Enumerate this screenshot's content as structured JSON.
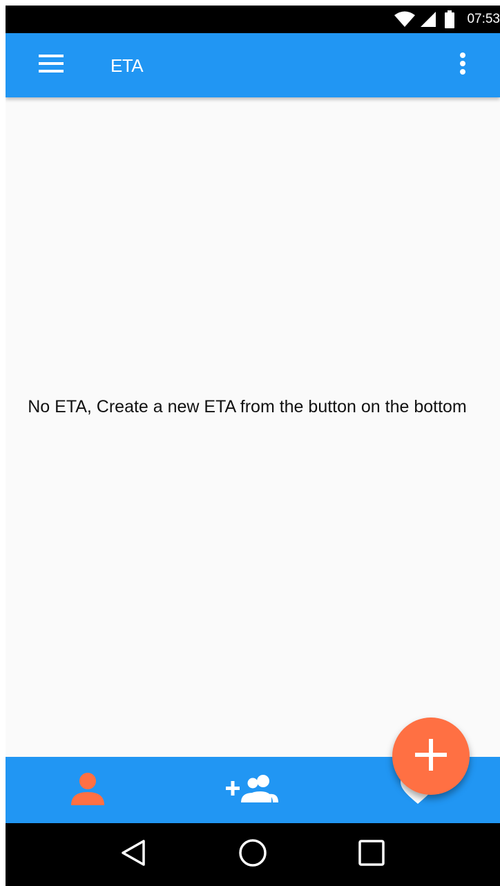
{
  "status_bar": {
    "time": "07:53",
    "icons": [
      "wifi-icon",
      "signal-icon",
      "battery-icon"
    ]
  },
  "app_bar": {
    "title": "ETA",
    "menu_icon": "menu-icon",
    "overflow_icon": "more-vert-icon"
  },
  "content": {
    "empty_message": "No ETA, Create a new ETA from the button on the bottom"
  },
  "fab": {
    "icon": "add-icon"
  },
  "bottom_nav": {
    "items": [
      {
        "icon": "person-icon",
        "active": true
      },
      {
        "icon": "group-add-icon",
        "active": false
      },
      {
        "icon": "heart-icon",
        "active": false
      }
    ]
  },
  "system_nav": {
    "buttons": [
      "back-icon",
      "home-icon",
      "recents-icon"
    ]
  },
  "colors": {
    "primary": "#2196f3",
    "accent": "#ff7043",
    "background": "#fafafa",
    "status_bar": "#000000"
  }
}
